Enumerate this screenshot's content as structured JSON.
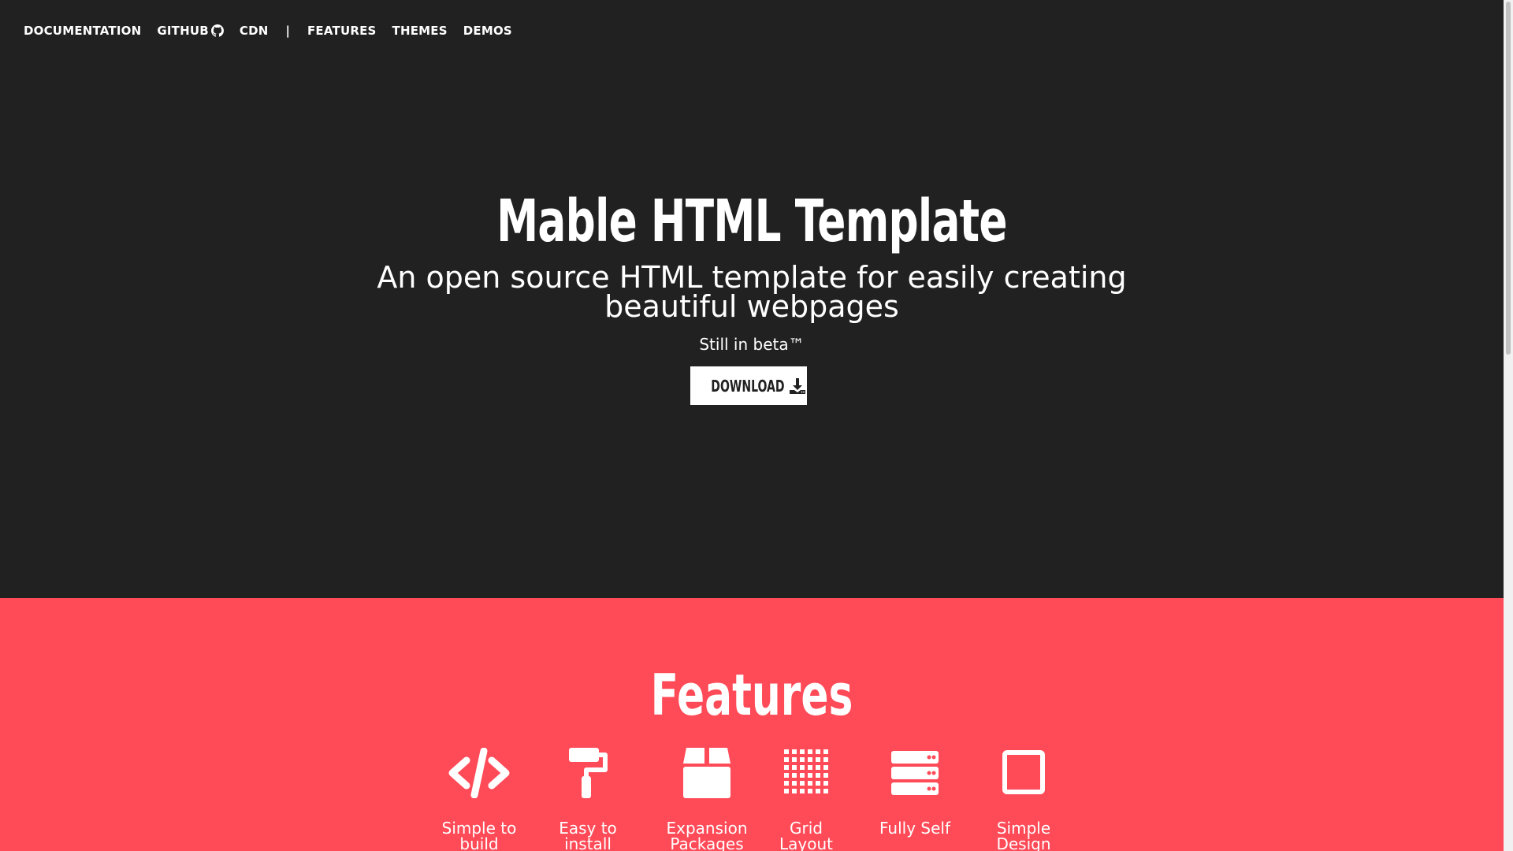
{
  "nav": {
    "items": [
      {
        "label": "DOCUMENTATION"
      },
      {
        "label": "GITHUB"
      },
      {
        "label": "CDN"
      },
      {
        "label": "|"
      },
      {
        "label": "FEATURES"
      },
      {
        "label": "THEMES"
      },
      {
        "label": "DEMOS"
      }
    ]
  },
  "hero": {
    "title": "Mable HTML Template",
    "subtitle": "An open source HTML template for easily creating beautiful webpages",
    "beta": "Still in beta™",
    "download_label": "DOWNLOAD"
  },
  "features": {
    "title": "Features",
    "items": [
      {
        "label": "Simple to build",
        "icon": "code-icon"
      },
      {
        "label": "Easy to install",
        "icon": "paint-roller-icon"
      },
      {
        "label": "Expansion Packages",
        "icon": "box-icon"
      },
      {
        "label": "Grid Layout",
        "icon": "grid-icon"
      },
      {
        "label": "Fully Self",
        "icon": "server-icon"
      },
      {
        "label": "Simple Design",
        "icon": "square-icon"
      }
    ]
  },
  "colors": {
    "hero_bg": "#212121",
    "features_bg": "#ff4a57",
    "text": "#ffffff"
  }
}
